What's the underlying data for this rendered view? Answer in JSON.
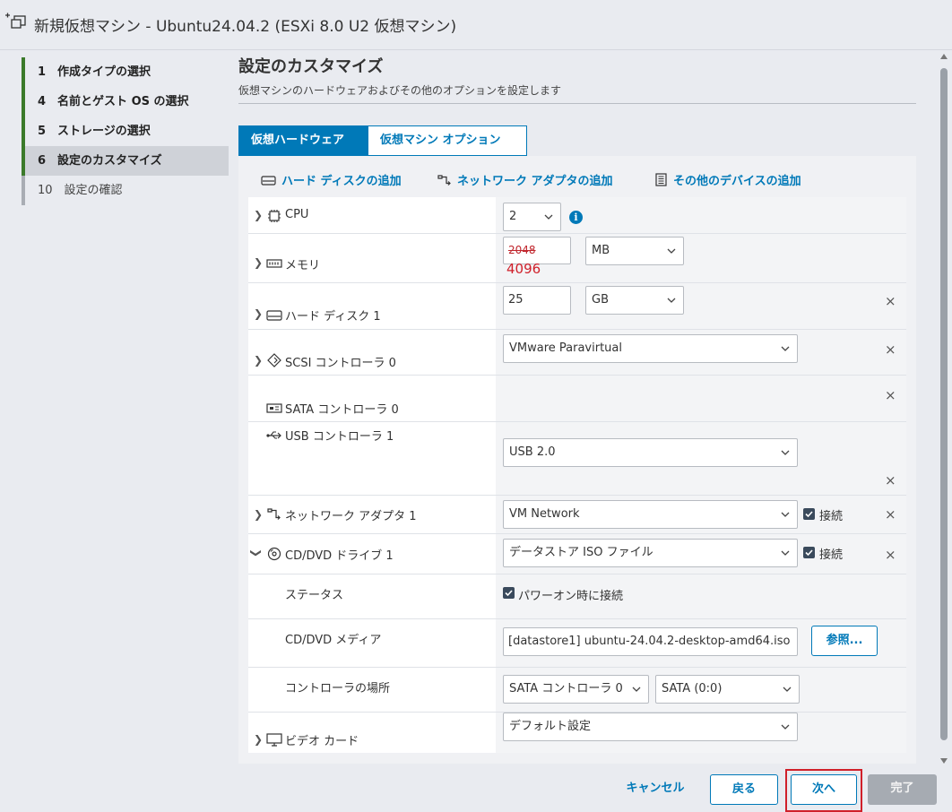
{
  "window": {
    "title": "新規仮想マシン - Ubuntu24.04.2 (ESXi 8.0 U2 仮想マシン)"
  },
  "steps": [
    {
      "label": "1　作成タイプの選択",
      "state": "done"
    },
    {
      "label": "4　名前とゲスト OS の選択",
      "state": "done"
    },
    {
      "label": "5　ストレージの選択",
      "state": "done"
    },
    {
      "label": "6　設定のカスタマイズ",
      "state": "current"
    },
    {
      "label": "10　設定の確認",
      "state": "future"
    }
  ],
  "page": {
    "title": "設定のカスタマイズ",
    "subtitle": "仮想マシンのハードウェアおよびその他のオプションを設定します"
  },
  "tabs": {
    "hardware": "仮想ハードウェア",
    "options": "仮想マシン オプション"
  },
  "actions": {
    "add_disk": "ハード ディスクの追加",
    "add_network": "ネットワーク アダプタの追加",
    "add_other": "その他のデバイスの追加"
  },
  "hardware": {
    "cpu": {
      "label": "CPU",
      "value": "2"
    },
    "memory": {
      "label": "メモリ",
      "old_value": "2048",
      "new_value": "4096",
      "unit": "MB"
    },
    "disk": {
      "label": "ハード ディスク 1",
      "value": "25",
      "unit": "GB"
    },
    "scsi": {
      "label": "SCSI コントローラ 0",
      "value": "VMware Paravirtual"
    },
    "sata": {
      "label": "SATA コントローラ 0"
    },
    "usb": {
      "label": "USB コントローラ 1",
      "value": "USB 2.0"
    },
    "network": {
      "label": "ネットワーク アダプタ 1",
      "value": "VM Network",
      "connect_label": "接続"
    },
    "cdrom": {
      "label": "CD/DVD ドライブ 1",
      "value": "データストア ISO ファイル",
      "connect_label": "接続",
      "status_label": "ステータス",
      "status_value": "パワーオン時に接続",
      "media_label": "CD/DVD メディア",
      "media_value": "[datastore1] ubuntu-24.04.2-desktop-amd64.iso",
      "browse_label": "参照...",
      "location_label": "コントローラの場所",
      "controller_value": "SATA コントローラ 0",
      "slot_value": "SATA (0:0)"
    },
    "video": {
      "label": "ビデオ カード",
      "value": "デフォルト設定"
    }
  },
  "remove_glyph": "×",
  "info_glyph": "i",
  "footer": {
    "cancel": "キャンセル",
    "back": "戻る",
    "next": "次へ",
    "finish": "完了"
  },
  "colors": {
    "accent": "#0079b8",
    "highlight": "#d0202a",
    "step_done": "#3b7a2a"
  }
}
